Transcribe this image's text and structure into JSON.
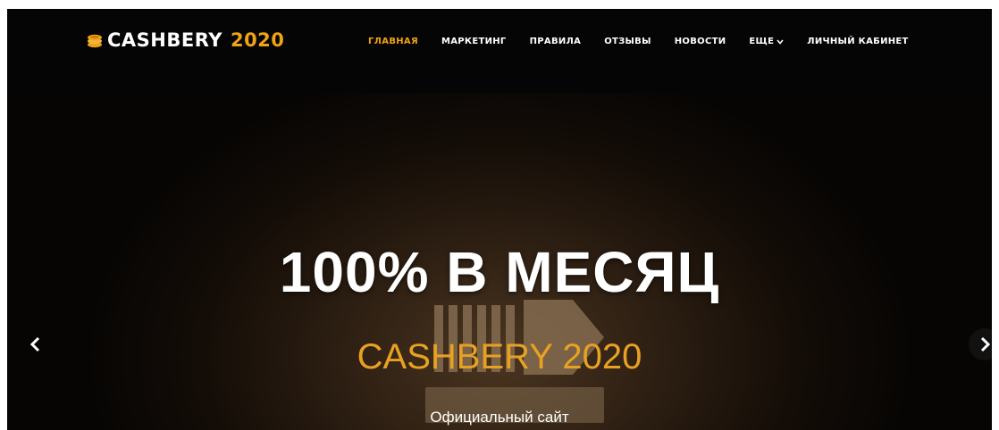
{
  "header": {
    "logo": {
      "name": "CASHBERY",
      "year": "2020",
      "icon": "coin-stack-icon"
    },
    "nav": [
      {
        "label": "ГЛАВНАЯ",
        "active": true
      },
      {
        "label": "МАРКЕТИНГ"
      },
      {
        "label": "ПРАВИЛА"
      },
      {
        "label": "ОТЗЫВЫ"
      },
      {
        "label": "НОВОСТИ"
      },
      {
        "label": "ЕЩЕ",
        "icon": "chevron-down-icon"
      },
      {
        "label": "ЛИЧНЫЙ КАБИНЕТ"
      }
    ]
  },
  "hero": {
    "headline": "100% В МЕСЯЦ",
    "subheadline": "CASHBERY 2020",
    "caption": "Официальный сайт",
    "prev_icon": "chevron-left-icon",
    "next_icon": "chevron-right-icon"
  },
  "colors": {
    "accent": "#f0a315",
    "background": "#000000",
    "text": "#ffffff"
  }
}
